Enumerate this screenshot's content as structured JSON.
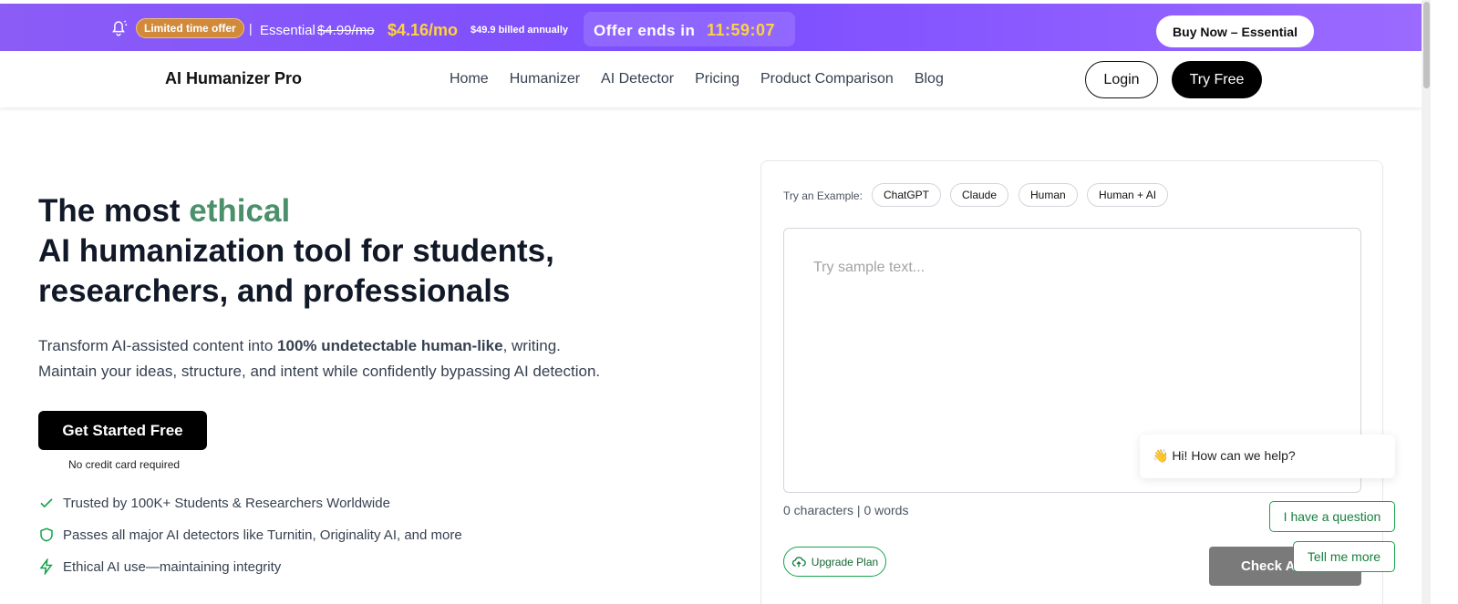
{
  "promo": {
    "badge": "Limited time offer",
    "separator": "|",
    "plan": "Essential",
    "old_price": "$4.99/mo",
    "new_price": "$4.16/mo",
    "billed": "$49.9 billed annually",
    "offer_label": "Offer ends in",
    "timer": "11:59:07",
    "buy_label": "Buy Now – Essential",
    "icon": "bell-icon",
    "bg_color": "#8b5cf6",
    "accent_color": "#ffd33d"
  },
  "nav": {
    "logo": "AI Humanizer Pro",
    "items": [
      "Home",
      "Humanizer",
      "AI Detector",
      "Pricing",
      "Product Comparison",
      "Blog"
    ],
    "login_label": "Login",
    "try_label": "Try Free"
  },
  "hero": {
    "title_prefix": "The most ",
    "title_accent": "ethical",
    "title_line2": "AI humanization tool for students,",
    "title_line3": "researchers, and professionals",
    "sub_prefix": "Transform AI-assisted content into ",
    "sub_bold": "100% undetectable human-like",
    "sub_suffix": ", writing.",
    "sub_line2": "Maintain your ideas, structure, and intent while confidently bypassing AI detection.",
    "cta_label": "Get Started Free",
    "no_card": "No credit card required",
    "features": [
      {
        "icon": "check-icon",
        "text": "Trusted by 100K+ Students & Researchers Worldwide"
      },
      {
        "icon": "shield-icon",
        "text": "Passes all major AI detectors like Turnitin, Originality AI, and more"
      },
      {
        "icon": "lightning-icon",
        "text": "Ethical AI use—maintaining integrity"
      }
    ],
    "accent_color": "#4b8f6b"
  },
  "tool": {
    "try_label": "Try an Example:",
    "examples": [
      "ChatGPT",
      "Claude",
      "Human",
      "Human + AI"
    ],
    "placeholder": "Try sample text...",
    "counts": "0 characters | 0 words",
    "upgrade_label": "Upgrade Plan",
    "check_label": "Check AI"
  },
  "chat": {
    "greeting": "👋 Hi! How can we help?",
    "options": [
      "I have a question",
      "Tell me more"
    ]
  }
}
